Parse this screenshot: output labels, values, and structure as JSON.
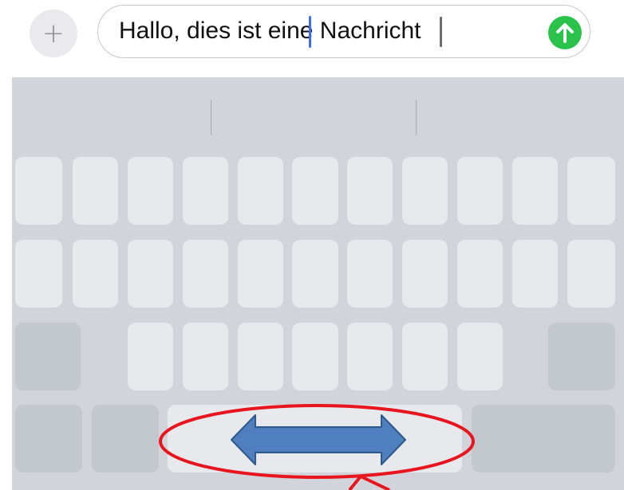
{
  "input_bar": {
    "plus_symbol": "+",
    "message_text": "Hallo, dies ist eine Nachricht",
    "send_icon": "arrow-up-icon",
    "send_color": "#2bc24c"
  },
  "keyboard": {
    "background_color": "#d1d5db",
    "key_color": "#e8e9ec",
    "special_key_color": "#c3c7ce",
    "row1_key_count": 11,
    "row2_key_count": 11,
    "row3_key_count": 7
  },
  "annotation": {
    "highlight_color": "#e8141e",
    "arrow_color": "#4f7fbf",
    "arrow_meaning": "double-headed-horizontal-arrow"
  }
}
